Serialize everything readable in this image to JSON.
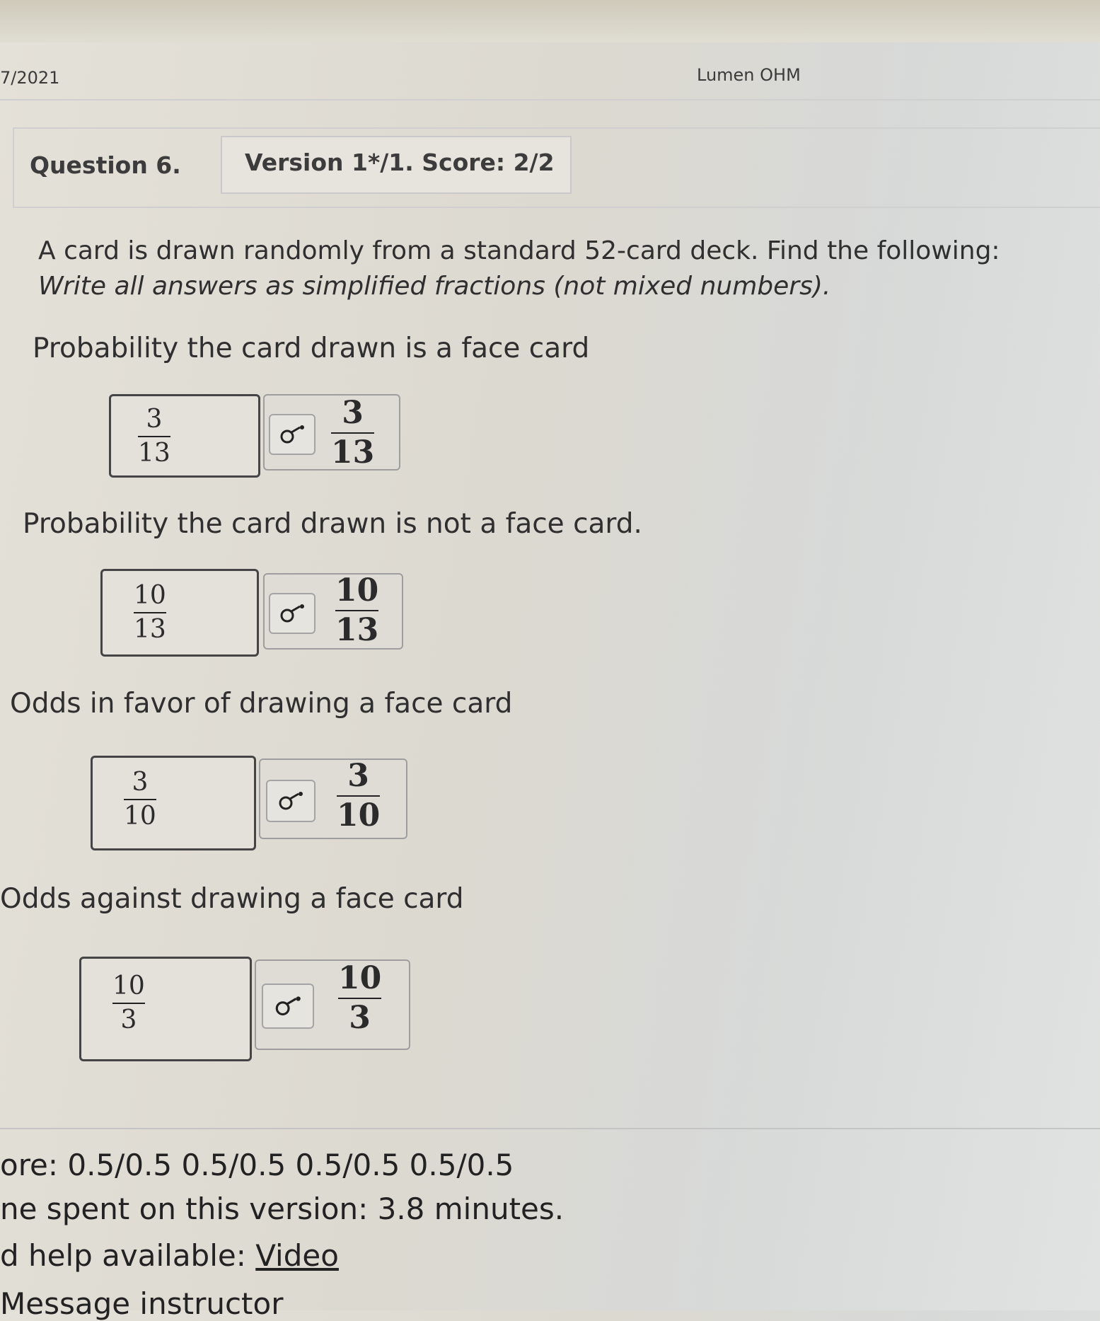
{
  "header": {
    "date": "7/2021",
    "app_name": "Lumen OHM"
  },
  "question": {
    "label": "Question 6.",
    "version": "Version 1*/1. Score: 2/2",
    "prompt_line1": "A card is drawn randomly from a standard 52-card deck. Find the following:",
    "prompt_line2": "Write all answers as simplified fractions (not mixed numbers)."
  },
  "parts": [
    {
      "label": "Probability the card drawn is a face card",
      "answer": {
        "num": "3",
        "den": "13"
      },
      "preview": {
        "num": "3",
        "den": "13"
      }
    },
    {
      "label": "Probability the card drawn is not a face card.",
      "answer": {
        "num": "10",
        "den": "13"
      },
      "preview": {
        "num": "10",
        "den": "13"
      }
    },
    {
      "label": "Odds in favor of drawing a face card",
      "answer": {
        "num": "3",
        "den": "10"
      },
      "preview": {
        "num": "3",
        "den": "10"
      }
    },
    {
      "label": "Odds against drawing a face card",
      "answer": {
        "num": "10",
        "den": "3"
      },
      "preview": {
        "num": "10",
        "den": "3"
      }
    }
  ],
  "footer": {
    "score": "ore: 0.5/0.5 0.5/0.5 0.5/0.5 0.5/0.5",
    "time_spent": "ne spent on this version: 3.8 minutes.",
    "help_prefix": "d help available: ",
    "help_link": "Video",
    "message": "Message instructor"
  },
  "icons": {
    "preview_icon": "preview-eye-icon"
  }
}
